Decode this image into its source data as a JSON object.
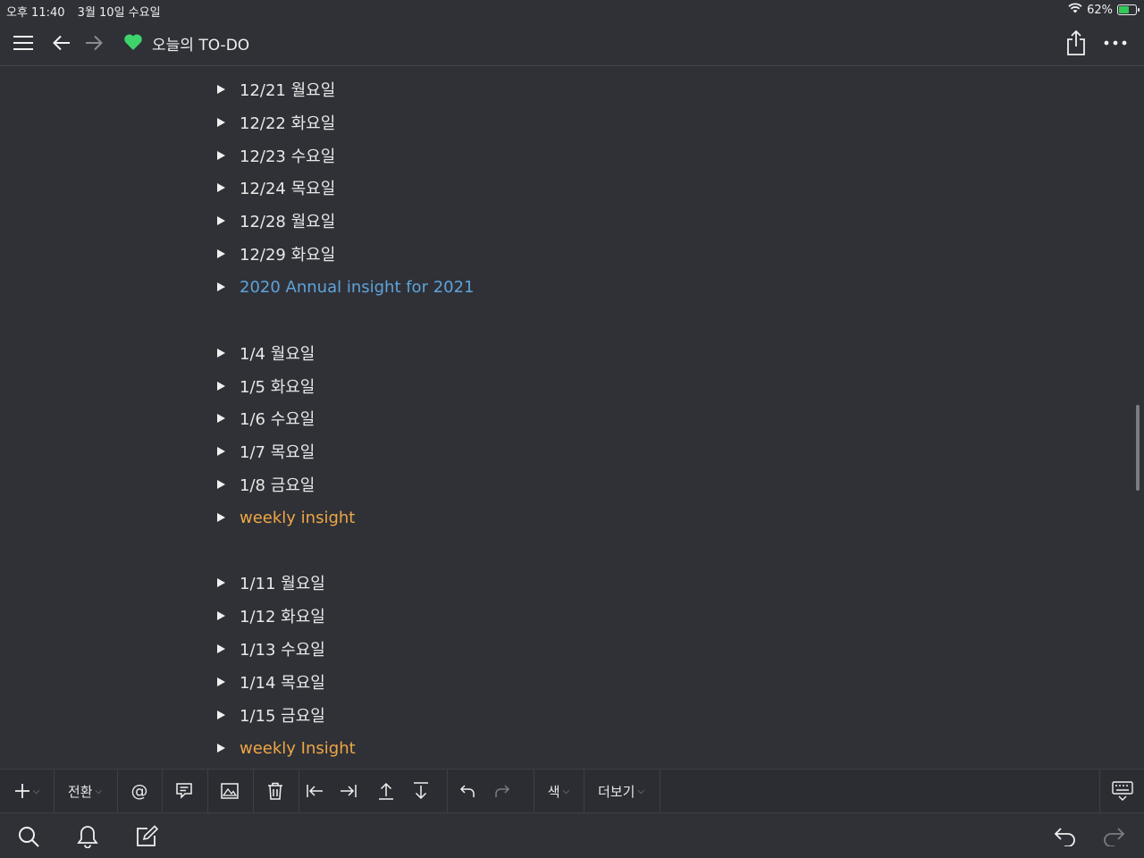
{
  "status": {
    "time": "오후 11:40",
    "date": "3월 10일 수요일",
    "battery": "62%",
    "battery_level": 0.62
  },
  "nav": {
    "title": "오늘의 TO-DO",
    "title_icon": "green-heart-icon"
  },
  "toggles": [
    {
      "text": "12/21 월요일",
      "color": "#e8e8e8"
    },
    {
      "text": "12/22 화요일",
      "color": "#e8e8e8"
    },
    {
      "text": "12/23 수요일",
      "color": "#e8e8e8"
    },
    {
      "text": "12/24 목요일",
      "color": "#e8e8e8"
    },
    {
      "text": "12/28 월요일",
      "color": "#e8e8e8"
    },
    {
      "text": "12/29 화요일",
      "color": "#e8e8e8"
    },
    {
      "text": "2020 Annual insight for 2021",
      "color": "#5fa3d9"
    },
    {
      "text": "1/4 월요일",
      "color": "#e8e8e8"
    },
    {
      "text": "1/5 화요일",
      "color": "#e8e8e8"
    },
    {
      "text": "1/6 수요일",
      "color": "#e8e8e8"
    },
    {
      "text": "1/7 목요일",
      "color": "#e8e8e8"
    },
    {
      "text": "1/8 금요일",
      "color": "#e8e8e8"
    },
    {
      "text": "weekly insight",
      "color": "#f0a645"
    },
    {
      "text": "1/11 월요일",
      "color": "#e8e8e8"
    },
    {
      "text": "1/12 화요일",
      "color": "#e8e8e8"
    },
    {
      "text": "1/13 수요일",
      "color": "#e8e8e8"
    },
    {
      "text": "1/14 목요일",
      "color": "#e8e8e8"
    },
    {
      "text": "1/15 금요일",
      "color": "#e8e8e8"
    },
    {
      "text": "weekly Insight",
      "color": "#f0a645"
    }
  ],
  "toolbar": {
    "switch_label": "전환",
    "mention_label": "@",
    "color_label": "색",
    "more_label": "더보기"
  }
}
